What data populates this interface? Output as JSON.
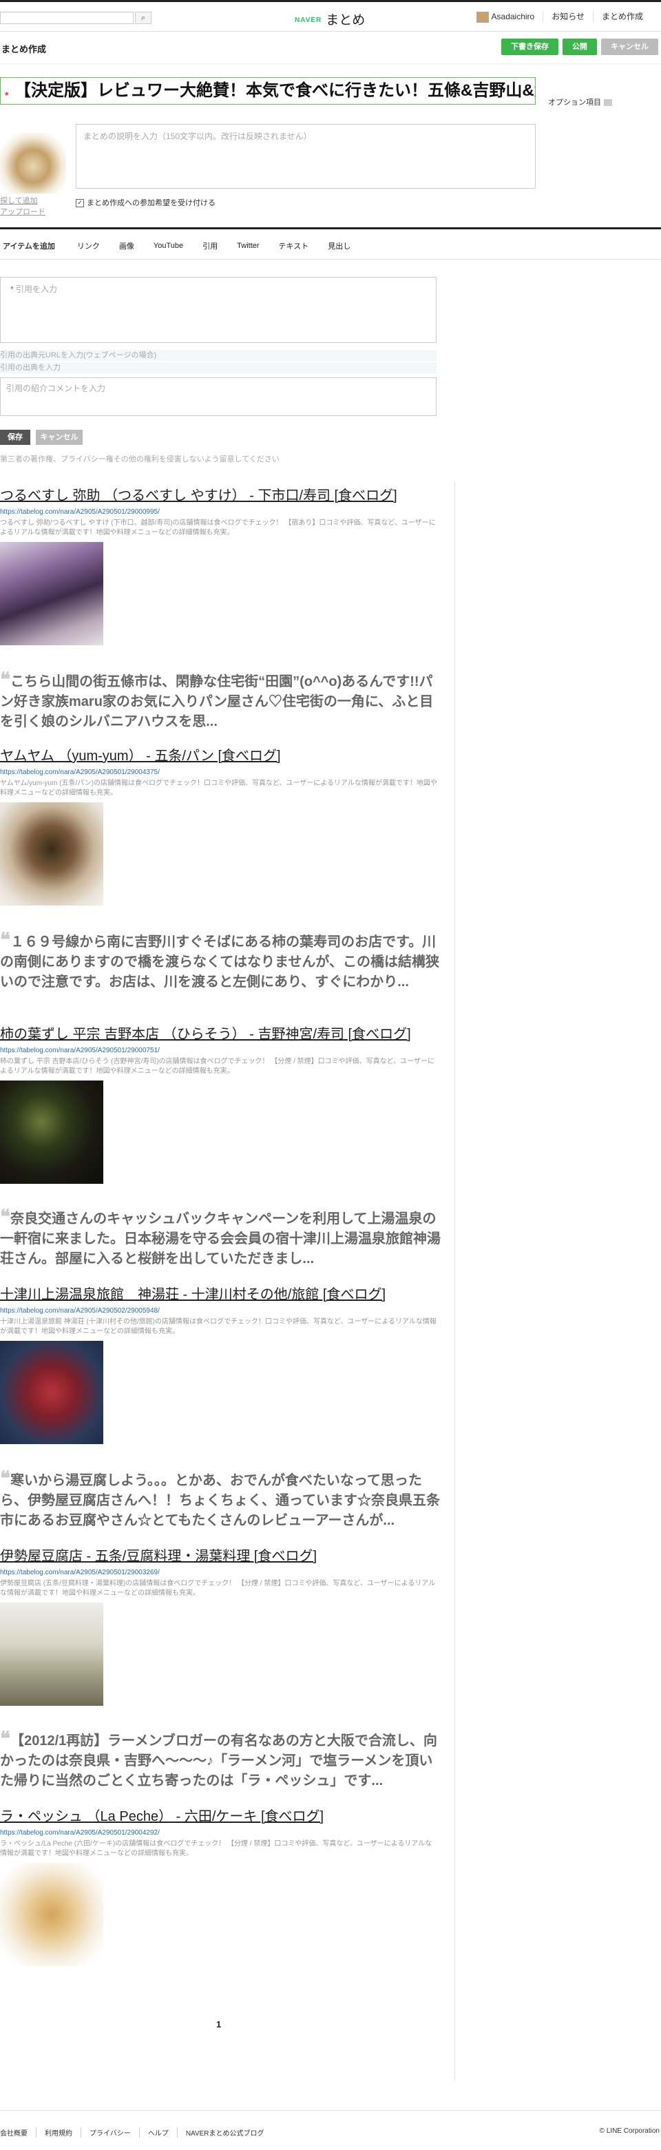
{
  "header": {
    "logo_brand": "NAVER",
    "logo_text": "まとめ",
    "search_icon": "search-icon",
    "user": "Asadaichiro",
    "notifications": "お知らせ",
    "create": "まとめ作成"
  },
  "editor": {
    "page_title": "まとめ作成",
    "draft_button": "下書き保存",
    "publish_button": "公開",
    "cancel_button": "キャンセル",
    "required_mark": "*",
    "title_value": "【決定版】レビュワー大絶賛！本気で食べに行きたい！五條&吉野山&大",
    "option_link": "オプション項目",
    "side_link_1": "探して追加",
    "side_link_2": "アップロード",
    "description_placeholder": "まとめの説明を入力（150文字以内。改行は反映されません）",
    "participation_check": "まとめ作成への参加希望を受け付ける",
    "check_mark": "✓"
  },
  "item_tabs": {
    "lead": "アイテムを追加",
    "tabs": [
      "リンク",
      "画像",
      "YouTube",
      "引用",
      "Twitter",
      "テキスト",
      "見出し"
    ]
  },
  "quote_form": {
    "quote_placeholder": "引用を入力",
    "source_url_placeholder": "引用の出典元URLを入力(ウェブページの場合)",
    "source_placeholder": "引用の出典を入力",
    "comment_placeholder": "引用の紹介コメントを入力",
    "save": "保存",
    "cancel": "キャンセル",
    "notice": "第三者の著作権、プライバシー権その他の権利を侵害しないよう留意してください"
  },
  "items": [
    {
      "title": "つるべすし 弥助 （つるべすし やすけ） - 下市口/寿司 [食べログ]",
      "url": "https://tabelog.com/nara/A2905/A290501/29000995/",
      "desc": "つるべすし 弥助/つるべすし やすけ (下市口、越部/寿司)の店舗情報は食べログでチェック！ 【宿あり】口コミや評価、写真など、ユーザーによるリアルな情報が満載です！地図や料理メニューなどの詳細情報も充実。"
    },
    {
      "title": "ヤムヤム （yum-yum） - 五条/パン [食べログ]",
      "url": "https://tabelog.com/nara/A2905/A290501/29004375/",
      "desc": "ヤムヤム/yum-yum (五条/パン)の店舗情報は食べログでチェック！口コミや評価、写真など、ユーザーによるリアルな情報が満載です！地図や料理メニューなどの詳細情報も充実。"
    },
    {
      "title": "柿の葉ずし 平宗 吉野本店 （ひらそう） - 吉野神宮/寿司 [食べログ]",
      "url": "https://tabelog.com/nara/A2905/A290501/29000751/",
      "desc": "柿の葉ずし 平宗 吉野本店/ひらそう (吉野神宮/寿司)の店舗情報は食べログでチェック！ 【分煙 / 禁煙】口コミや評価、写真など、ユーザーによるリアルな情報が満載です！地図や料理メニューなどの詳細情報も充実。"
    },
    {
      "title": "十津川上湯温泉旅館　神湯荘 - 十津川村その他/旅館 [食べログ]",
      "url": "https://tabelog.com/nara/A2905/A290502/29005948/",
      "desc": "十津川上湯温泉旅館 神湯荘 (十津川村その他/旅館)の店舗情報は食べログでチェック！口コミや評価、写真など、ユーザーによるリアルな情報が満載です！地図や料理メニューなどの詳細情報も充実。"
    },
    {
      "title": "伊勢屋豆腐店 - 五条/豆腐料理・湯葉料理 [食べログ]",
      "url": "https://tabelog.com/nara/A2905/A290501/29003269/",
      "desc": "伊勢屋豆腐店 (五条/豆腐料理・湯葉料理)の店舗情報は食べログでチェック！ 【分煙 / 禁煙】口コミや評価、写真など、ユーザーによるリアルな情報が満載です！地図や料理メニューなどの詳細情報も充実。"
    },
    {
      "title": "ラ・ペッシュ （La Peche） - 六田/ケーキ [食べログ]",
      "url": "https://tabelog.com/nara/A2905/A290501/29004292/",
      "desc": "ラ・ペッシュ/La Peche (六田/ケーキ)の店舗情報は食べログでチェック！ 【分煙 / 禁煙】口コミや評価、写真など、ユーザーによるリアルな情報が満載です！地図や料理メニューなどの詳細情報も充実。"
    }
  ],
  "quotes": [
    "こちら山間の街五條市は、閑静な住宅街“田園”(o^^o)あるんです!!パン好き家族maru家のお気に入りパン屋さん♡住宅街の一角に、ふと目を引く娘のシルバニアハウスを思...",
    "１６９号線から南に吉野川すぐそばにある柿の葉寿司のお店です。川の南側にありますので橋を渡らなくてはなりませんが、この橋は結構狭いので注意です。お店は、川を渡ると左側にあり、すぐにわかり...",
    "奈良交通さんのキャッシュバックキャンペーンを利用して上湯温泉の一軒宿に来ました。日本秘湯を守る会会員の宿十津川上湯温泉旅館神湯荘さん。部屋に入ると桜餅を出していただきまし...",
    "寒いから湯豆腐しよう。。。とかあ、おでんが食べたいなって思ったら、伊勢屋豆腐店さんへ！！ちょくちょく、通っています☆奈良県五条市にあるお豆腐やさん☆とてもたくさんのレビューアーさんが...",
    "【2012/1再訪】ラーメンブロガーの有名なあの方と大阪で合流し、向かったのは奈良県・吉野へ〜〜〜♪「ラーメン河」で塩ラーメンを頂いた帰りに当然のごとく立ち寄ったのは「ラ・ペッシュ」です..."
  ],
  "pager": {
    "current": "1"
  },
  "footer": {
    "links": [
      "会社概要",
      "利用規約",
      "プライバシー",
      "ヘルプ",
      "NAVERまとめ公式ブログ"
    ],
    "copyright": "© LINE Corporation"
  }
}
